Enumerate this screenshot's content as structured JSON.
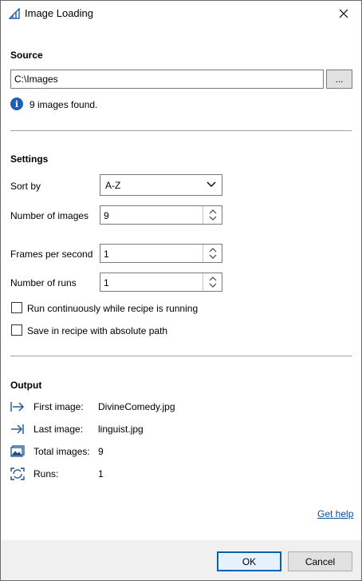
{
  "window": {
    "title": "Image Loading"
  },
  "source": {
    "heading": "Source",
    "path": "C:\\Images",
    "browse_label": "...",
    "info": "9 images found."
  },
  "settings": {
    "heading": "Settings",
    "sort_by_label": "Sort by",
    "sort_by_value": "A-Z",
    "num_images_label": "Number of images",
    "num_images_value": "9",
    "fps_label": "Frames per second",
    "fps_value": "1",
    "num_runs_label": "Number of runs",
    "num_runs_value": "1",
    "run_continuously_label": "Run continuously while recipe is running",
    "run_continuously_checked": false,
    "save_absolute_label": "Save in recipe with absolute path",
    "save_absolute_checked": false
  },
  "output": {
    "heading": "Output",
    "first_image_label": "First image:",
    "first_image_value": "DivineComedy.jpg",
    "last_image_label": "Last image:",
    "last_image_value": "linguist.jpg",
    "total_images_label": "Total images:",
    "total_images_value": "9",
    "runs_label": "Runs:",
    "runs_value": "1"
  },
  "links": {
    "help": "Get help"
  },
  "footer": {
    "ok_label": "OK",
    "cancel_label": "Cancel"
  },
  "colors": {
    "accent": "#0a5fb0",
    "info": "#1e5fb4",
    "link": "#0b4f9c"
  }
}
